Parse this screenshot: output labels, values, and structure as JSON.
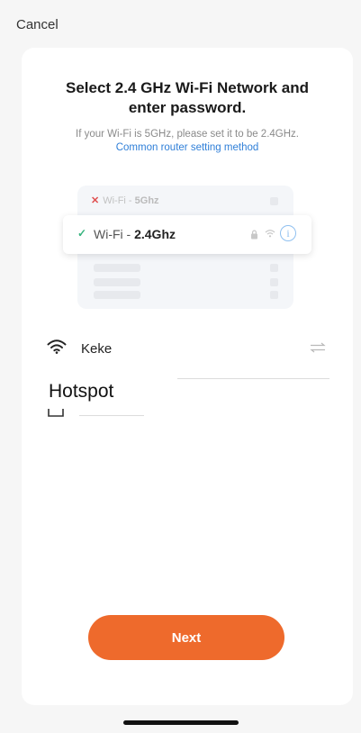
{
  "header": {
    "cancel_label": "Cancel"
  },
  "card": {
    "title_line1": "Select 2.4 GHz Wi-Fi Network and",
    "title_line2": "enter password.",
    "hint": "If your Wi-Fi is 5GHz, please set it to be 2.4GHz.",
    "link": "Common router setting method"
  },
  "illustration": {
    "unsupported_prefix": "Wi-Fi - ",
    "unsupported_band": "5Ghz",
    "supported_prefix": "Wi-Fi - ",
    "supported_band": "2.4Ghz",
    "accent_ok": "#36b37e",
    "accent_bad": "#e05050"
  },
  "network": {
    "ssid": "Keke",
    "annotation": "Hotspot",
    "password_value": ""
  },
  "actions": {
    "next_label": "Next",
    "next_color": "#ee6a2c"
  }
}
